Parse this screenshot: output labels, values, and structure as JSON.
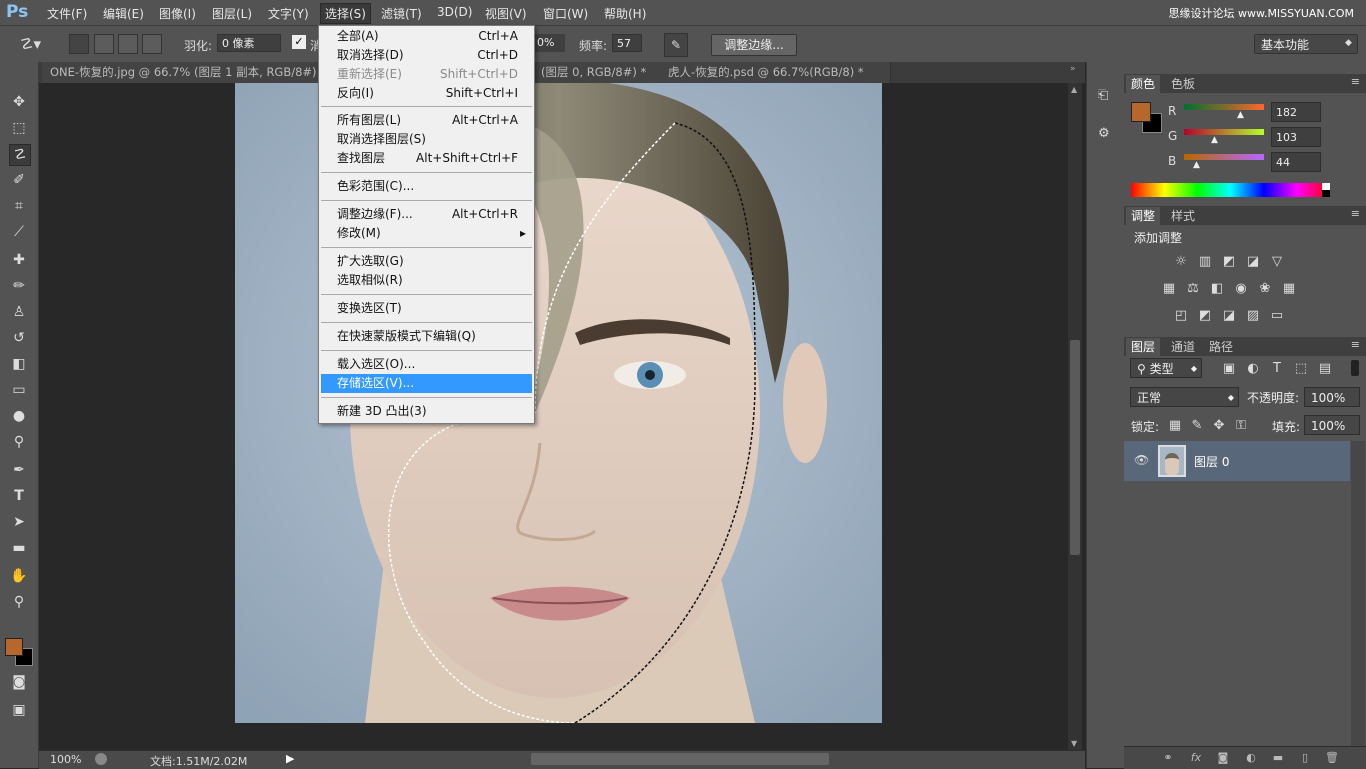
{
  "app": {
    "logo": "Ps",
    "watermark": "思缘设计论坛 www.MISSYUAN.COM"
  },
  "menubar": {
    "items": [
      "文件(F)",
      "编辑(E)",
      "图像(I)",
      "图层(L)",
      "文字(Y)",
      "选择(S)",
      "滤镜(T)",
      "3D(D)",
      "视图(V)",
      "窗口(W)",
      "帮助(H)"
    ],
    "active": "选择(S)"
  },
  "options": {
    "feather_label": "羽化:",
    "feather_value": "0 像素",
    "antialias_check": "✓",
    "antialias_label": "消",
    "contrast_value": "0%",
    "frequency_label": "频率:",
    "frequency_value": "57",
    "refine_edge": "调整边缘...",
    "workspace": "基本功能"
  },
  "tabs": [
    {
      "label": "ONE-恢复的.jpg @ 66.7% (图层 1 副本, RGB/8#)",
      "close": "×"
    },
    {
      "label": "(图层 0, RGB/8#) *",
      "close": "×"
    },
    {
      "label": "虎人-恢复的.psd @ 66.7%(RGB/8) *",
      "close": "×"
    }
  ],
  "status": {
    "zoom": "100%",
    "doc_info": "文档:1.51M/2.02M"
  },
  "select_menu": {
    "items": [
      {
        "label": "全部(A)",
        "shortcut": "Ctrl+A",
        "state": "normal"
      },
      {
        "label": "取消选择(D)",
        "shortcut": "Ctrl+D",
        "state": "normal"
      },
      {
        "label": "重新选择(E)",
        "shortcut": "Shift+Ctrl+D",
        "state": "disabled"
      },
      {
        "label": "反向(I)",
        "shortcut": "Shift+Ctrl+I",
        "state": "normal"
      },
      {
        "label": "所有图层(L)",
        "shortcut": "Alt+Ctrl+A",
        "state": "normal"
      },
      {
        "label": "取消选择图层(S)",
        "shortcut": "",
        "state": "normal"
      },
      {
        "label": "查找图层",
        "shortcut": "Alt+Shift+Ctrl+F",
        "state": "normal"
      },
      {
        "label": "色彩范围(C)...",
        "shortcut": "",
        "state": "normal"
      },
      {
        "label": "调整边缘(F)...",
        "shortcut": "Alt+Ctrl+R",
        "state": "normal"
      },
      {
        "label": "修改(M)",
        "shortcut": "▸",
        "state": "normal"
      },
      {
        "label": "扩大选取(G)",
        "shortcut": "",
        "state": "normal"
      },
      {
        "label": "选取相似(R)",
        "shortcut": "",
        "state": "normal"
      },
      {
        "label": "变换选区(T)",
        "shortcut": "",
        "state": "normal"
      },
      {
        "label": "在快速蒙版模式下编辑(Q)",
        "shortcut": "",
        "state": "normal"
      },
      {
        "label": "载入选区(O)...",
        "shortcut": "",
        "state": "normal"
      },
      {
        "label": "存储选区(V)...",
        "shortcut": "",
        "state": "highlighted"
      },
      {
        "label": "新建 3D 凸出(3)",
        "shortcut": "",
        "state": "normal"
      }
    ]
  },
  "color_panel": {
    "tabs": [
      "颜色",
      "色板"
    ],
    "r_label": "R",
    "g_label": "G",
    "b_label": "B",
    "r": "182",
    "g": "103",
    "b": "44",
    "foreground": "#b6672c"
  },
  "adjust_panel": {
    "tabs": [
      "调整",
      "样式"
    ],
    "title": "添加调整"
  },
  "layers_panel": {
    "tabs": [
      "图层",
      "通道",
      "路径"
    ],
    "filter": "类型",
    "blend_mode": "正常",
    "opacity_label": "不透明度:",
    "opacity": "100%",
    "lock_label": "锁定:",
    "fill_label": "填充:",
    "fill": "100%",
    "layer_name": "图层 0"
  }
}
